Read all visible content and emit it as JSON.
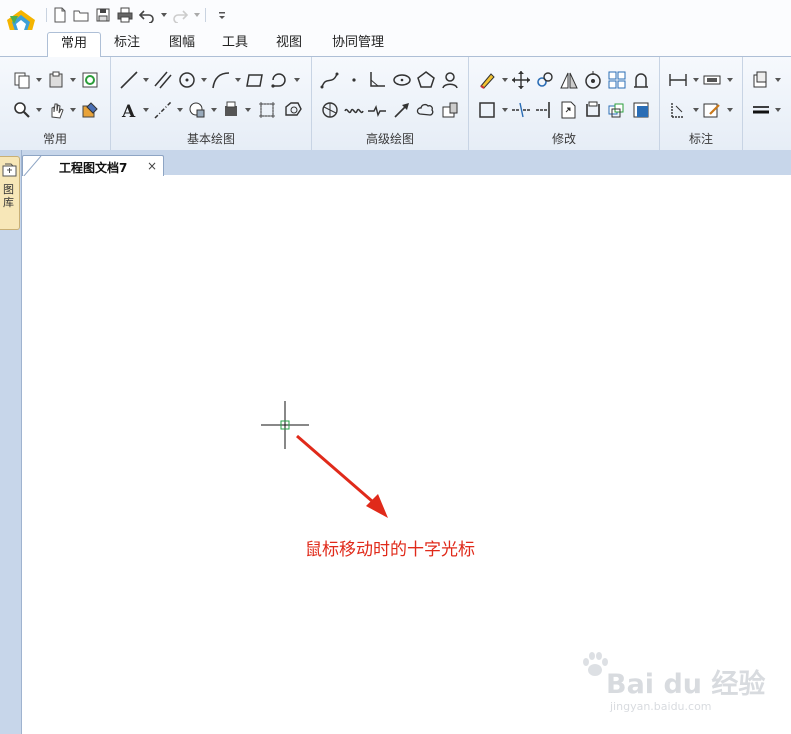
{
  "ribbon_tabs": [
    "常用",
    "标注",
    "图幅",
    "工具",
    "视图",
    "协同管理"
  ],
  "active_tab": "常用",
  "ribbon_groups": [
    "常用",
    "基本绘图",
    "高级绘图",
    "修改",
    "标注"
  ],
  "left_panel": {
    "label": "图库"
  },
  "document_tab": {
    "title": "工程图文档7",
    "close_glyph": "×"
  },
  "annotation": {
    "text": "鼠标移动时的十字光标",
    "color": "#e02a1a"
  },
  "watermark": {
    "brand": "Bai du 经验",
    "url": "jingyan.baidu.com"
  },
  "colors": {
    "ribbon_bg": "#e6edf6",
    "panel_blue": "#c7d6ea",
    "cursor_box": "#2aa04a",
    "arrow": "#e02a1a"
  }
}
